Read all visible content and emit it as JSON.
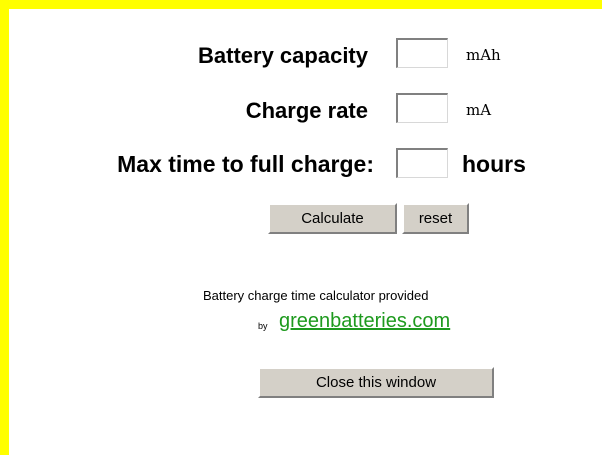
{
  "form": {
    "fields": [
      {
        "label": "Battery capacity",
        "unit": "mAh",
        "value": ""
      },
      {
        "label": "Charge rate",
        "unit": "mA",
        "value": ""
      },
      {
        "label": "Max time to full charge:",
        "unit": "hours",
        "value": ""
      }
    ],
    "calculate_label": "Calculate",
    "reset_label": "reset"
  },
  "credit": {
    "line1": "Battery charge time calculator provided",
    "by": "by",
    "link_text": "greenbatteries.com"
  },
  "close_label": "Close this window",
  "colors": {
    "border": "#ffff00",
    "link": "#1e9a1e",
    "button_face": "#d4d0c8"
  }
}
